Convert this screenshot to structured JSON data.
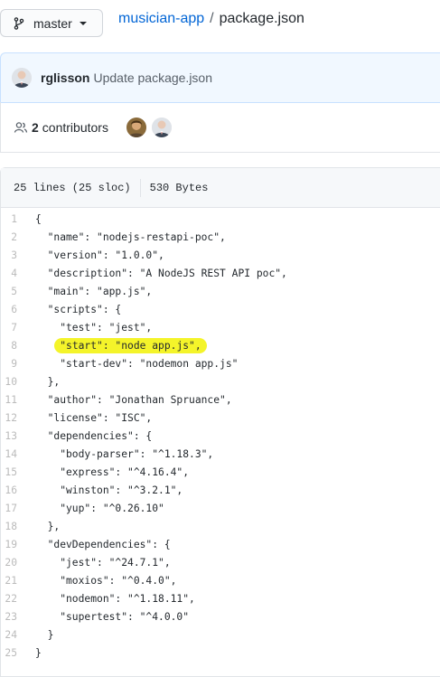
{
  "branch": {
    "label": "master"
  },
  "breadcrumb": {
    "repo": "musician-app",
    "separator": "/",
    "file": "package.json"
  },
  "commit": {
    "author": "rglisson",
    "message": "Update package.json"
  },
  "contributors": {
    "count": "2",
    "label": "contributors"
  },
  "file_info": {
    "lines": "25 lines (25 sloc)",
    "size": "530 Bytes"
  },
  "highlight_color": "#f4f42a",
  "code": [
    {
      "n": "1",
      "t": "{"
    },
    {
      "n": "2",
      "t": "  \"name\": \"nodejs-restapi-poc\","
    },
    {
      "n": "3",
      "t": "  \"version\": \"1.0.0\","
    },
    {
      "n": "4",
      "t": "  \"description\": \"A NodeJS REST API poc\","
    },
    {
      "n": "5",
      "t": "  \"main\": \"app.js\","
    },
    {
      "n": "6",
      "t": "  \"scripts\": {"
    },
    {
      "n": "7",
      "t": "    \"test\": \"jest\","
    },
    {
      "n": "8",
      "t": "\"start\": \"node app.js\",",
      "indent": "    ",
      "highlight": true
    },
    {
      "n": "9",
      "t": "    \"start-dev\": \"nodemon app.js\""
    },
    {
      "n": "10",
      "t": "  },"
    },
    {
      "n": "11",
      "t": "  \"author\": \"Jonathan Spruance\","
    },
    {
      "n": "12",
      "t": "  \"license\": \"ISC\","
    },
    {
      "n": "13",
      "t": "  \"dependencies\": {"
    },
    {
      "n": "14",
      "t": "    \"body-parser\": \"^1.18.3\","
    },
    {
      "n": "15",
      "t": "    \"express\": \"^4.16.4\","
    },
    {
      "n": "16",
      "t": "    \"winston\": \"^3.2.1\","
    },
    {
      "n": "17",
      "t": "    \"yup\": \"^0.26.10\""
    },
    {
      "n": "18",
      "t": "  },"
    },
    {
      "n": "19",
      "t": "  \"devDependencies\": {"
    },
    {
      "n": "20",
      "t": "    \"jest\": \"^24.7.1\","
    },
    {
      "n": "21",
      "t": "    \"moxios\": \"^0.4.0\","
    },
    {
      "n": "22",
      "t": "    \"nodemon\": \"^1.18.11\","
    },
    {
      "n": "23",
      "t": "    \"supertest\": \"^4.0.0\""
    },
    {
      "n": "24",
      "t": "  }"
    },
    {
      "n": "25",
      "t": "}"
    }
  ]
}
